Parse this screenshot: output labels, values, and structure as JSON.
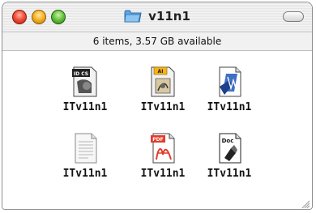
{
  "window": {
    "title": "v11n1",
    "title_icon": "folder-icon",
    "status_text": "6 items, 3.57 GB available"
  },
  "items": [
    {
      "label": "ITv11n1",
      "icon": "id-cs-document-icon"
    },
    {
      "label": "ITv11n1",
      "icon": "illustrator-document-icon"
    },
    {
      "label": "ITv11n1",
      "icon": "word-document-icon"
    },
    {
      "label": "ITv11n1",
      "icon": "text-document-icon"
    },
    {
      "label": "ITv11n1",
      "icon": "pdf-document-icon"
    },
    {
      "label": "ITv11n1",
      "icon": "doc-document-icon"
    }
  ],
  "icon_text": {
    "id_badge": "ID CS",
    "ai_badge": "AI",
    "pdf_badge": "PDF",
    "doc_badge": "Doc"
  },
  "colors": {
    "close": "#f0513c",
    "minimize": "#f6b42a",
    "zoom": "#6cc443",
    "folder": "#5aa6e6",
    "pdf_red": "#e53a2a"
  }
}
